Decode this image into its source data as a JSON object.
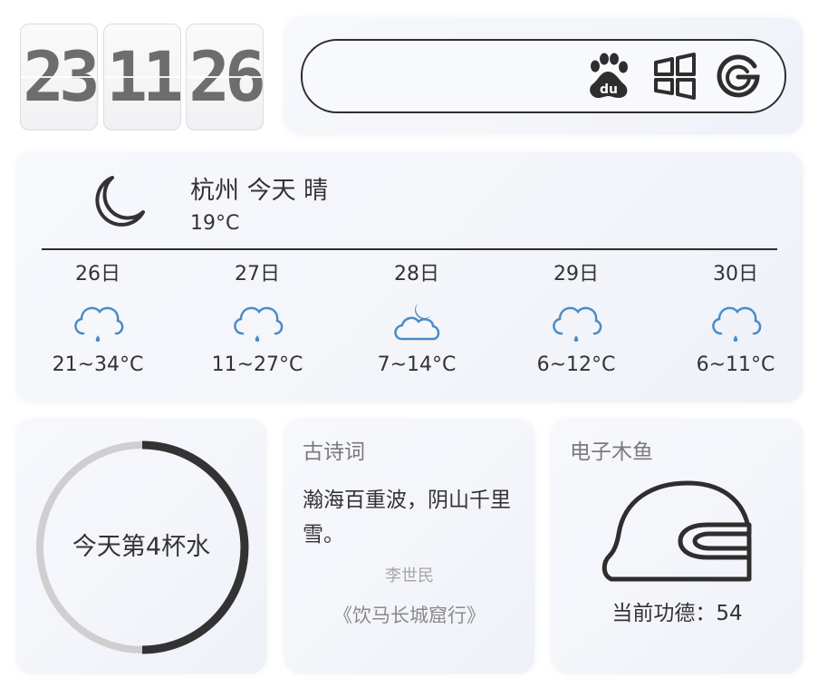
{
  "clock": {
    "hours": "23",
    "minutes": "11",
    "seconds": "26"
  },
  "search": {
    "value": "",
    "engines": [
      "baidu-icon",
      "bing-windows-icon",
      "google-icon"
    ]
  },
  "weather": {
    "summary": "杭州 今天 晴",
    "temp": "19°C",
    "now_icon": "moon-icon",
    "forecast": [
      {
        "date": "26日",
        "icon": "rain-cloud-icon",
        "range": "21~34°C"
      },
      {
        "date": "27日",
        "icon": "rain-cloud-icon",
        "range": "11~27°C"
      },
      {
        "date": "28日",
        "icon": "cloudy-night-icon",
        "range": "7~14°C"
      },
      {
        "date": "29日",
        "icon": "rain-cloud-icon",
        "range": "6~12°C"
      },
      {
        "date": "30日",
        "icon": "rain-cloud-icon",
        "range": "6~11°C"
      }
    ]
  },
  "water": {
    "label": "今天第4杯水",
    "progress_fraction": 0.5
  },
  "poem": {
    "title": "古诗词",
    "text": "瀚海百重波，阴山千里雪。",
    "author": "李世民",
    "source": "《饮马长城窟行》"
  },
  "muyu": {
    "title": "电子木鱼",
    "merit": "当前功德：54"
  },
  "colors": {
    "accent": "#333333",
    "rain_icon": "#4a8cc7",
    "ring_track": "#cfcfcf"
  }
}
